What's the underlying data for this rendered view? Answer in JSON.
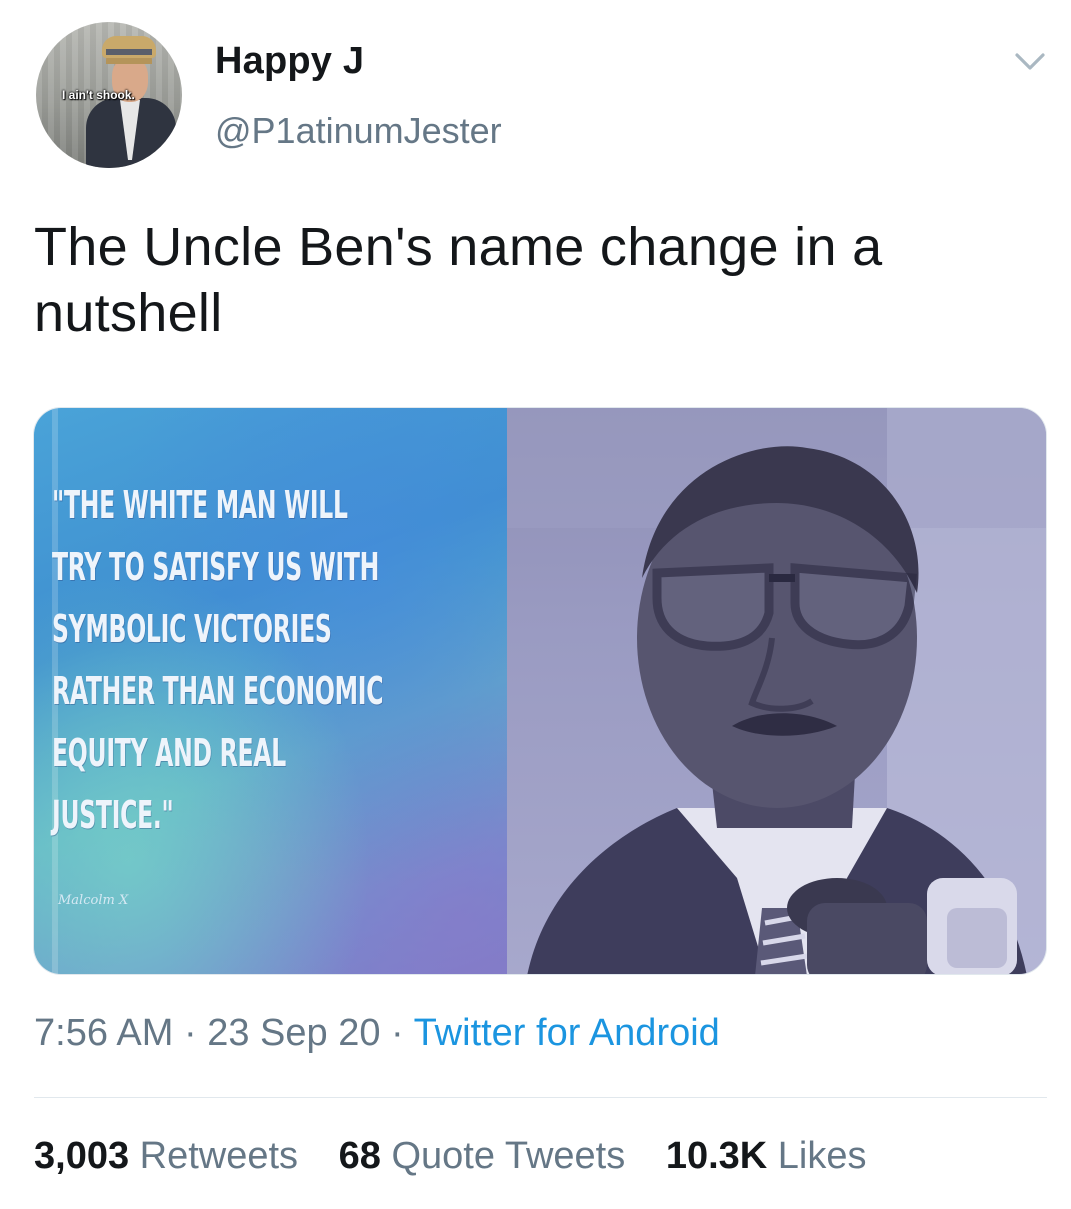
{
  "user": {
    "display_name": "Happy J",
    "handle": "@P1atinumJester",
    "avatar_caption": "I ain't shook."
  },
  "tweet": {
    "text": "The Uncle Ben's name change in a nutshell"
  },
  "media": {
    "quote_lines": [
      "\"THE WHITE MAN WILL",
      "TRY TO SATISFY US WITH",
      "SYMBOLIC VICTORIES",
      "RATHER THAN ECONOMIC",
      "EQUITY AND REAL",
      "JUSTICE.\""
    ],
    "attribution": "Malcolm X"
  },
  "meta": {
    "time": "7:56 AM",
    "date": "23 Sep 20",
    "source": "Twitter for Android",
    "separator": "·"
  },
  "stats": {
    "retweets_count": "3,003",
    "retweets_label": "Retweets",
    "quotes_count": "68",
    "quotes_label": "Quote Tweets",
    "likes_count": "10.3K",
    "likes_label": "Likes"
  },
  "colors": {
    "text": "#14171a",
    "secondary": "#657786",
    "link": "#1b95e0",
    "divider": "#e1e8ed"
  },
  "icons": {
    "menu": "chevron-down-icon"
  }
}
